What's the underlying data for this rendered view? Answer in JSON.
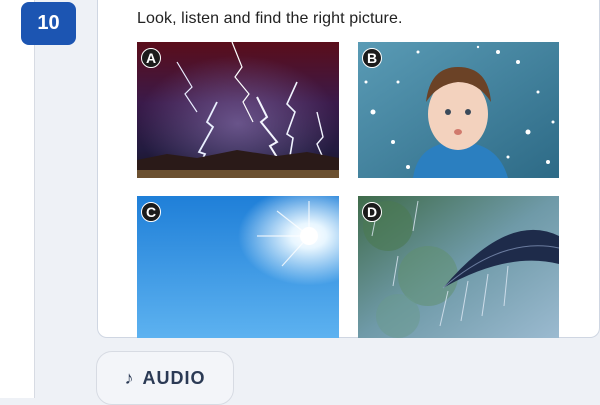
{
  "question": {
    "number": "10",
    "prompt": "Look, listen and find the right picture."
  },
  "options": [
    {
      "label": "A"
    },
    {
      "label": "B"
    },
    {
      "label": "C"
    },
    {
      "label": "D"
    }
  ],
  "audio_button": {
    "icon": "♪",
    "label": "AUDIO"
  }
}
